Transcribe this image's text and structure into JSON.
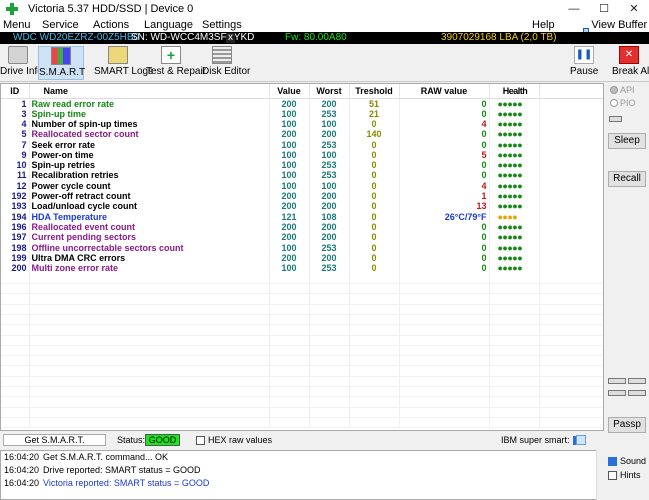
{
  "window": {
    "title": "Victoria 5.37 HDD/SSD | Device 0"
  },
  "menu": {
    "items": [
      "Menu",
      "Service",
      "Actions",
      "Language",
      "Settings"
    ],
    "help": "Help",
    "view_buffer": "View Buffer Live"
  },
  "device": {
    "model": "WDC WD20EZRZ-00Z5HB0",
    "serial": "SN: WD-WCC4M3SFDYKD",
    "close": "x",
    "firmware": "Fw: 80.00A80",
    "lba": "3907029168 LBA (2,0 TB)"
  },
  "toolbar": {
    "drive_info": "Drive Info",
    "smart": "S.M.A.R.T",
    "smart_logs": "SMART Logs",
    "test_repair": "Test & Repair",
    "disk_editor": "Disk Editor",
    "pause": "Pause",
    "break_all": "Break All"
  },
  "table": {
    "headers": {
      "id": "ID",
      "name": "Name",
      "value": "Value",
      "worst": "Worst",
      "treshold": "Treshold",
      "raw": "RAW value",
      "health": "Health"
    },
    "rows": [
      {
        "id": "1",
        "name": "Raw read error rate",
        "value": "200",
        "worst": "200",
        "treshold": "51",
        "raw": "0",
        "health": "●●●●●",
        "color": "#138a13"
      },
      {
        "id": "3",
        "name": "Spin-up time",
        "value": "100",
        "worst": "253",
        "treshold": "21",
        "raw": "0",
        "health": "●●●●●",
        "color": "#138a13"
      },
      {
        "id": "4",
        "name": "Number of spin-up times",
        "value": "100",
        "worst": "100",
        "treshold": "0",
        "raw": "4",
        "health": "●●●●●",
        "color": "#000000"
      },
      {
        "id": "5",
        "name": "Reallocated sector count",
        "value": "200",
        "worst": "200",
        "treshold": "140",
        "raw": "0",
        "health": "●●●●●",
        "color": "#8a1a8a"
      },
      {
        "id": "7",
        "name": "Seek error rate",
        "value": "100",
        "worst": "253",
        "treshold": "0",
        "raw": "0",
        "health": "●●●●●",
        "color": "#000000"
      },
      {
        "id": "9",
        "name": "Power-on time",
        "value": "100",
        "worst": "100",
        "treshold": "0",
        "raw": "5",
        "health": "●●●●●",
        "color": "#000000"
      },
      {
        "id": "10",
        "name": "Spin-up retries",
        "value": "100",
        "worst": "253",
        "treshold": "0",
        "raw": "0",
        "health": "●●●●●",
        "color": "#000000"
      },
      {
        "id": "11",
        "name": "Recalibration retries",
        "value": "100",
        "worst": "253",
        "treshold": "0",
        "raw": "0",
        "health": "●●●●●",
        "color": "#000000"
      },
      {
        "id": "12",
        "name": "Power cycle count",
        "value": "100",
        "worst": "100",
        "treshold": "0",
        "raw": "4",
        "health": "●●●●●",
        "color": "#000000"
      },
      {
        "id": "192",
        "name": "Power-off retract count",
        "value": "200",
        "worst": "200",
        "treshold": "0",
        "raw": "1",
        "health": "●●●●●",
        "color": "#000000"
      },
      {
        "id": "193",
        "name": "Load/unload cycle count",
        "value": "200",
        "worst": "200",
        "treshold": "0",
        "raw": "13",
        "health": "●●●●●",
        "color": "#000000"
      },
      {
        "id": "194",
        "name": "HDA Temperature",
        "value": "121",
        "worst": "108",
        "treshold": "0",
        "raw": "26°C/79°F",
        "health": "●●●●",
        "color": "#1a3ad6"
      },
      {
        "id": "196",
        "name": "Reallocated event count",
        "value": "200",
        "worst": "200",
        "treshold": "0",
        "raw": "0",
        "health": "●●●●●",
        "color": "#8a1a8a"
      },
      {
        "id": "197",
        "name": "Current pending sectors",
        "value": "200",
        "worst": "200",
        "treshold": "0",
        "raw": "0",
        "health": "●●●●●",
        "color": "#8a1a8a"
      },
      {
        "id": "198",
        "name": "Offline uncorrectable sectors count",
        "value": "100",
        "worst": "253",
        "treshold": "0",
        "raw": "0",
        "health": "●●●●●",
        "color": "#8a1a8a"
      },
      {
        "id": "199",
        "name": "Ultra DMA CRC errors",
        "value": "200",
        "worst": "200",
        "treshold": "0",
        "raw": "0",
        "health": "●●●●●",
        "color": "#000000"
      },
      {
        "id": "200",
        "name": "Multi zone error rate",
        "value": "100",
        "worst": "253",
        "treshold": "0",
        "raw": "0",
        "health": "●●●●●",
        "color": "#8a1a8a"
      }
    ]
  },
  "side": {
    "api": "API",
    "pio": "PIO",
    "sleep": "Sleep",
    "recall": "Recall",
    "passp": "Passp"
  },
  "status": {
    "get_smart": "Get S.M.A.R.T.",
    "status_label": "Status:",
    "status_value": "GOOD",
    "hex_raw": "HEX raw values",
    "ibm": "IBM super smart:"
  },
  "log": [
    {
      "time": "16:04:20",
      "msg": "Get S.M.A.R.T. command... OK",
      "blue": false
    },
    {
      "time": "16:04:20",
      "msg": "Drive reported: SMART status = GOOD",
      "blue": false
    },
    {
      "time": "16:04:20",
      "msg": "Victoria reported: SMART status = GOOD",
      "blue": true
    }
  ],
  "bottom_opts": {
    "sound": "Sound",
    "hints": "Hints"
  }
}
